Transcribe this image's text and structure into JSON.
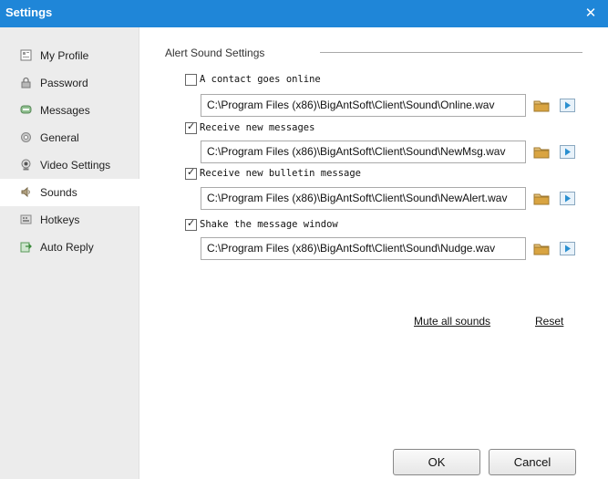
{
  "window": {
    "title": "Settings"
  },
  "sidebar": {
    "items": [
      {
        "label": "My Profile",
        "icon": "profile-card-icon",
        "active": false
      },
      {
        "label": "Password",
        "icon": "lock-icon",
        "active": false
      },
      {
        "label": "Messages",
        "icon": "message-icon",
        "active": false
      },
      {
        "label": "General",
        "icon": "gear-icon",
        "active": false
      },
      {
        "label": "Video Settings",
        "icon": "webcam-icon",
        "active": false
      },
      {
        "label": "Sounds",
        "icon": "speaker-icon",
        "active": true
      },
      {
        "label": "Hotkeys",
        "icon": "keyboard-icon",
        "active": false
      },
      {
        "label": "Auto Reply",
        "icon": "auto-reply-icon",
        "active": false
      }
    ]
  },
  "main": {
    "section_title": "Alert Sound Settings",
    "sounds": [
      {
        "label": "A contact goes online",
        "checked": false,
        "path": "C:\\Program Files (x86)\\BigAntSoft\\Client\\Sound\\Online.wav"
      },
      {
        "label": "Receive new messages",
        "checked": true,
        "path": "C:\\Program Files (x86)\\BigAntSoft\\Client\\Sound\\NewMsg.wav"
      },
      {
        "label": "Receive new bulletin message",
        "checked": true,
        "path": "C:\\Program Files (x86)\\BigAntSoft\\Client\\Sound\\NewAlert.wav"
      },
      {
        "label": "Shake the message window",
        "checked": true,
        "path": "C:\\Program Files (x86)\\BigAntSoft\\Client\\Sound\\Nudge.wav"
      }
    ],
    "mute_all_label": "Mute all sounds",
    "reset_label": "Reset"
  },
  "footer": {
    "ok_label": "OK",
    "cancel_label": "Cancel"
  },
  "colors": {
    "titlebar": "#1f86d8",
    "sidebar": "#ececec",
    "folder": "#d9a441",
    "play": "#2a8fd0"
  }
}
